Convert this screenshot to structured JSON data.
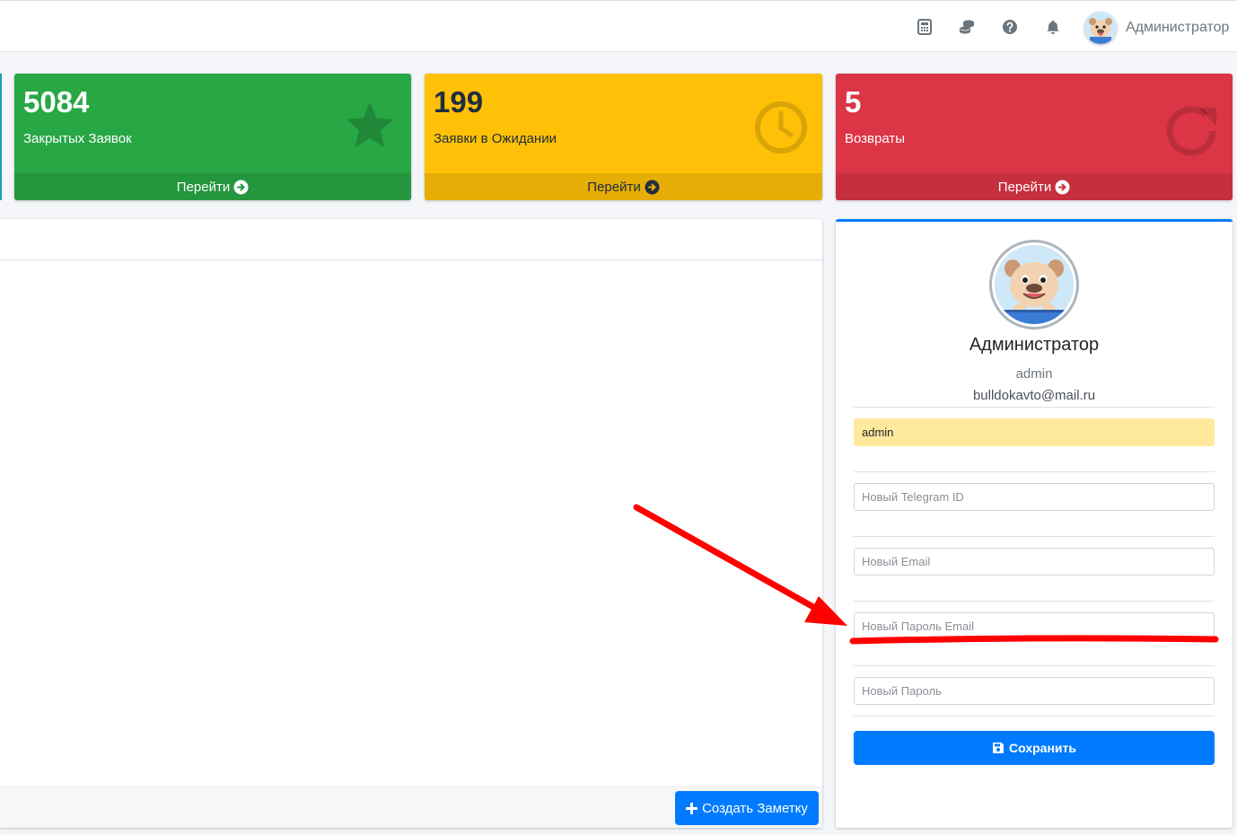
{
  "navbar": {
    "icons": [
      "calculator-icon",
      "coins-icon",
      "help-icon",
      "bell-icon"
    ],
    "user_name": "Администратор"
  },
  "stats": [
    {
      "value": "5084",
      "label": "Закрытых Заявок",
      "link": "Перейти",
      "icon": "star-icon",
      "color": "#28a745"
    },
    {
      "value": "199",
      "label": "Заявки в Ожидании",
      "link": "Перейти",
      "icon": "clock-icon",
      "color": "#ffc107"
    },
    {
      "value": "5",
      "label": "Возвраты",
      "link": "Перейти",
      "icon": "redo-icon",
      "color": "#dc3545"
    }
  ],
  "notes": {
    "create_button": "Создать Заметку"
  },
  "profile": {
    "name": "Администратор",
    "login": "admin",
    "email": "bulldokavto@mail.ru",
    "login_field_value": "admin",
    "telegram_placeholder": "Новый Telegram ID",
    "email_placeholder": "Новый Email",
    "email_password_placeholder": "Новый Пароль Email",
    "password_placeholder": "Новый Пароль",
    "save_button": "Сохранить"
  },
  "colors": {
    "primary": "#007bff",
    "annotation": "#ff0000"
  }
}
